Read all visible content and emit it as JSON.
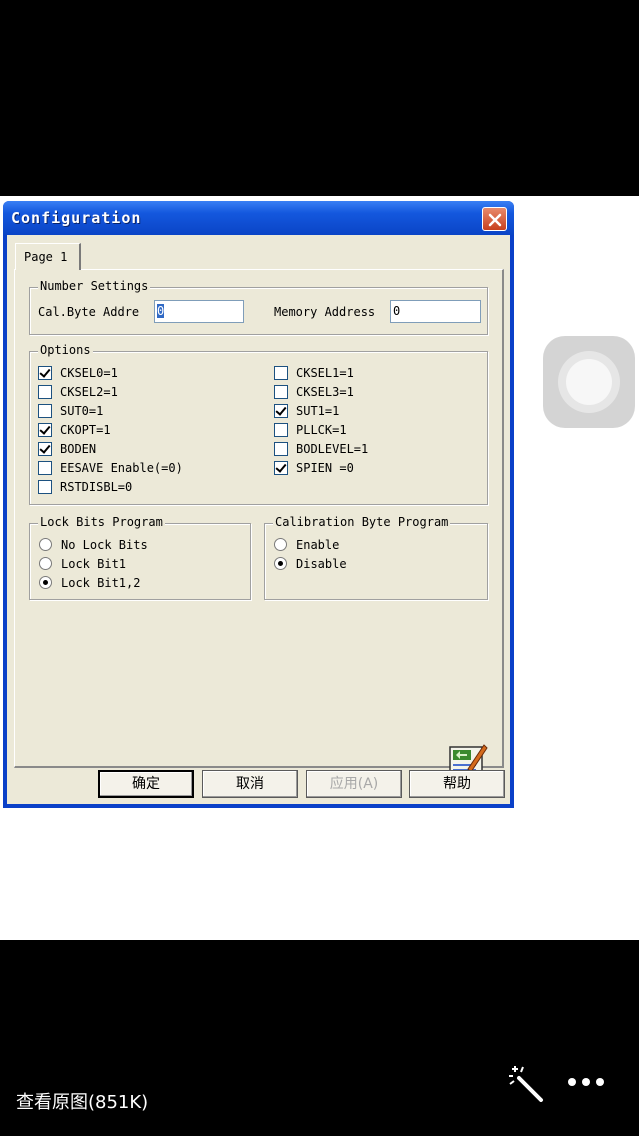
{
  "dialog": {
    "title": "Configuration",
    "tab": "Page 1",
    "number_settings": {
      "title": "Number Settings",
      "cal_byte_label": "Cal.Byte Addre",
      "cal_byte_value": "0",
      "memory_label": "Memory Address",
      "memory_value": "0"
    },
    "options": {
      "title": "Options",
      "left": [
        {
          "label": "CKSEL0=1",
          "checked": true
        },
        {
          "label": "CKSEL2=1",
          "checked": false
        },
        {
          "label": "SUT0=1",
          "checked": false
        },
        {
          "label": "CKOPT=1",
          "checked": true
        },
        {
          "label": "BODEN",
          "checked": true
        },
        {
          "label": "EESAVE Enable(=0)",
          "checked": false
        },
        {
          "label": "RSTDISBL=0",
          "checked": false
        }
      ],
      "right": [
        {
          "label": "CKSEL1=1",
          "checked": false
        },
        {
          "label": "CKSEL3=1",
          "checked": false
        },
        {
          "label": "SUT1=1",
          "checked": true
        },
        {
          "label": "PLLCK=1",
          "checked": false
        },
        {
          "label": "BODLEVEL=1",
          "checked": false
        },
        {
          "label": "SPIEN =0",
          "checked": true
        }
      ]
    },
    "lock_bits": {
      "title": "Lock Bits Program",
      "items": [
        {
          "label": "No Lock Bits",
          "selected": false
        },
        {
          "label": "Lock Bit1",
          "selected": false
        },
        {
          "label": "Lock Bit1,2",
          "selected": true
        }
      ]
    },
    "calibration": {
      "title": "Calibration Byte Program",
      "items": [
        {
          "label": "Enable",
          "selected": false
        },
        {
          "label": "Disable",
          "selected": true
        }
      ]
    },
    "buttons": {
      "ok": "确定",
      "cancel": "取消",
      "apply": "应用(A)",
      "help": "帮助"
    }
  },
  "viewer": {
    "view_original": "查看原图(851K)",
    "magic_icon": "magic-wand-icon",
    "more_icon": "more-icon"
  }
}
